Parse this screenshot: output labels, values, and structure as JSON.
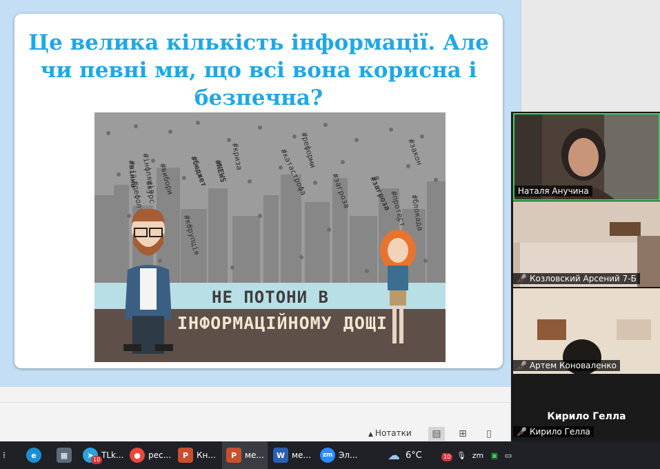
{
  "slide": {
    "title_lines": [
      "Це велика кількість інформації. Але",
      "чи певні ми, що всі вона корисна і",
      "безпечна?"
    ],
    "poster": {
      "caption_1": "НЕ ПОТОНИ В",
      "caption_2": "ІНФОРМАЦІЙНОМУ ДОЩІ",
      "rain_words": [
        "#інфляція",
        "#вибори",
        "#бюджет",
        "#NEWS",
        "#криза",
        "#реформи",
        "#війна",
        "#загроза",
        "#катастрофа",
        "#корупція",
        "#блокада",
        "#дефолт",
        "#протест",
        "#закон",
        "#курс",
        "#загроза"
      ]
    }
  },
  "status": {
    "notes_label": "Нотатки"
  },
  "zoom": {
    "participants": [
      {
        "name": "Наталя Анучина",
        "muted": false
      },
      {
        "name": "Козловский Арсений 7-Б",
        "muted": true
      },
      {
        "name": "Артем Коноваленко",
        "muted": true
      },
      {
        "name": "Кирило Гелла",
        "muted": true,
        "center_label": "Кирило Гелла"
      }
    ],
    "active_color": "#3cd35b"
  },
  "taskbar": {
    "items": [
      {
        "label": "TLk...",
        "icon": "telegram-icon",
        "badge": "10"
      },
      {
        "label": "рес...",
        "icon": "chrome-icon"
      },
      {
        "label": "Кн...",
        "icon": "powerpoint-icon"
      },
      {
        "label": "ме...",
        "icon": "powerpoint-icon"
      },
      {
        "label": "ме...",
        "icon": "word-icon"
      },
      {
        "label": "Эл...",
        "icon": "zoom-icon"
      }
    ],
    "weather": "6°C",
    "tray_badge": "10"
  }
}
